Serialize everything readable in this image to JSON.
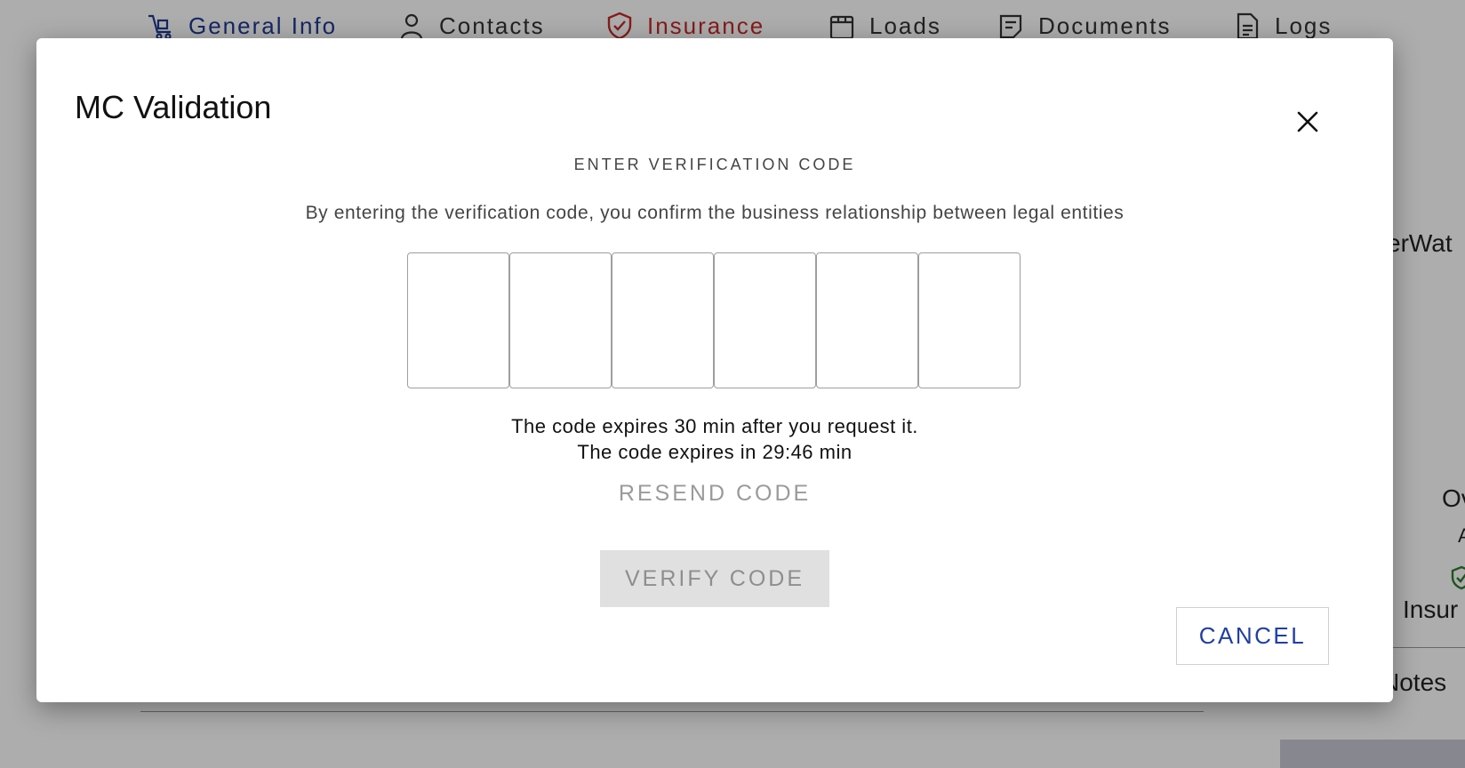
{
  "background": {
    "tabs": [
      {
        "label": "General Info",
        "icon": "truck-icon",
        "color": "#1f3a93"
      },
      {
        "label": "Contacts",
        "icon": "person-icon"
      },
      {
        "label": "Insurance",
        "icon": "shield-check-icon",
        "color": "#c62828"
      },
      {
        "label": "Loads",
        "icon": "box-icon"
      },
      {
        "label": "Documents",
        "icon": "document-icon"
      },
      {
        "label": "Logs",
        "icon": "log-file-icon"
      }
    ],
    "side_fragments": [
      "erWat",
      "Ov",
      "A",
      "Insur",
      "Notes"
    ]
  },
  "modal": {
    "title": "MC Validation",
    "heading": "ENTER VERIFICATION CODE",
    "description": "By entering the verification code, you confirm the business relationship between legal entities",
    "code_length": 6,
    "code_values": [
      "",
      "",
      "",
      "",
      "",
      ""
    ],
    "expire_note": "The code expires 30 min after you request it.",
    "expire_countdown": "The code expires in 29:46 min",
    "resend_label": "RESEND CODE",
    "verify_label": "VERIFY CODE",
    "cancel_label": "CANCEL",
    "colors": {
      "primary": "#1f3fa3",
      "disabled_bg": "#e0e0e0",
      "disabled_text": "#8e8e8e"
    }
  }
}
